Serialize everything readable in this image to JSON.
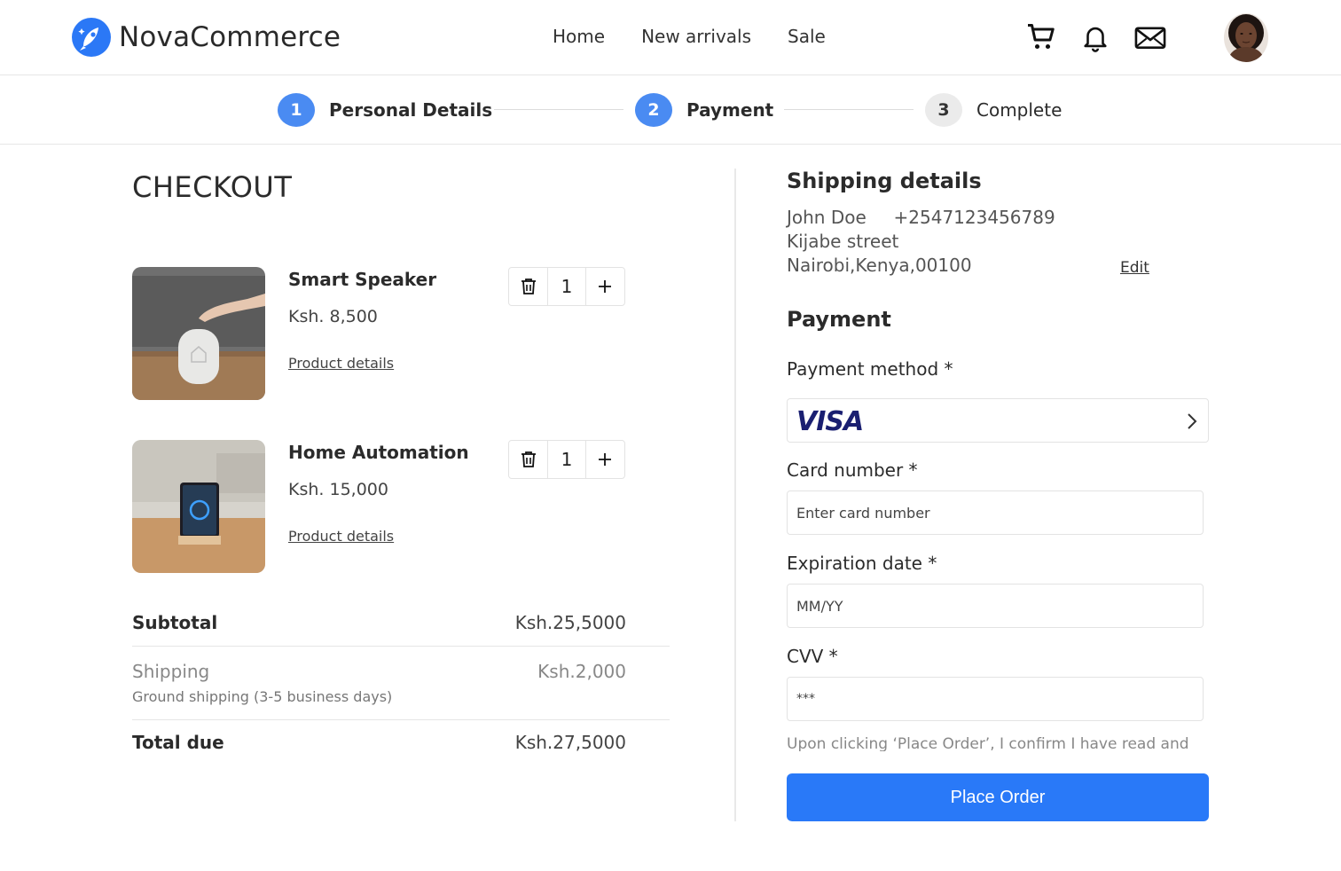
{
  "brand": {
    "name": "NovaCommerce",
    "accent": "#2979f8"
  },
  "nav": {
    "items": [
      "Home",
      "New arrivals",
      "Sale"
    ]
  },
  "header_icons": [
    "cart-icon",
    "bell-icon",
    "mail-icon"
  ],
  "stepper": {
    "steps": [
      {
        "num": "1",
        "label": "Personal Details",
        "state": "active"
      },
      {
        "num": "2",
        "label": "Payment",
        "state": "active"
      },
      {
        "num": "3",
        "label": "Complete",
        "state": "todo"
      }
    ]
  },
  "checkout": {
    "title": "CHECKOUT",
    "items": [
      {
        "name": "Smart Speaker",
        "price": "Ksh. 8,500",
        "qty": "1",
        "details_link": "Product details"
      },
      {
        "name": "Home Automation",
        "price": "Ksh. 15,000",
        "qty": "1",
        "details_link": "Product details"
      }
    ],
    "summary": {
      "subtotal_label": "Subtotal",
      "subtotal_value": "Ksh.25,5000",
      "shipping_label": "Shipping",
      "shipping_value": "Ksh.2,000",
      "shipping_note": "Ground shipping (3-5 business days)",
      "total_label": "Total due",
      "total_value": "Ksh.27,5000"
    }
  },
  "shipping": {
    "title": "Shipping details",
    "name": "John Doe",
    "phone": "+2547123456789",
    "street": "Kijabe street",
    "city": "Nairobi,Kenya,00100",
    "edit_label": "Edit"
  },
  "payment": {
    "title": "Payment",
    "method_label": "Payment method *",
    "method_value": "VISA",
    "card_label": "Card number *",
    "card_placeholder": "Enter card number",
    "exp_label": "Expiration date *",
    "exp_placeholder": "MM/YY",
    "cvv_label": "CVV *",
    "cvv_value": "***",
    "consent": "Upon clicking ‘Place Order’, I confirm  I have read and",
    "place_order": "Place Order"
  }
}
